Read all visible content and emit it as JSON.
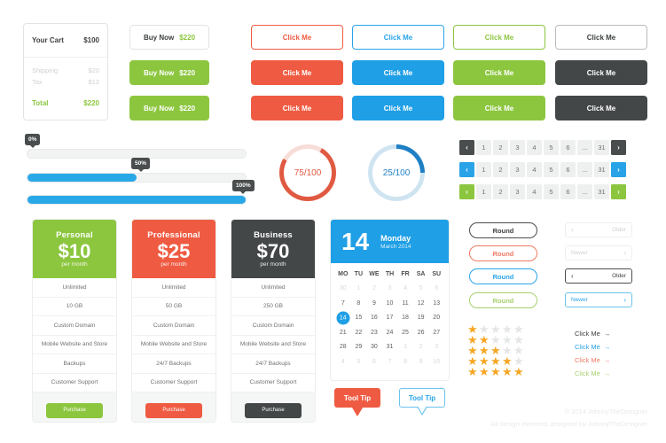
{
  "cart": {
    "title": "Your Cart",
    "total_top": "$100",
    "rows": [
      {
        "label": "Shipping",
        "value": "$20"
      },
      {
        "label": "Tax",
        "value": "$12"
      }
    ],
    "total_label": "Total",
    "total_value": "$220"
  },
  "buy": {
    "label": "Buy Now",
    "amount": "$220",
    "variants": [
      "outline",
      "solid",
      "solid"
    ]
  },
  "click_buttons": {
    "label": "Click Me",
    "columns": [
      "red",
      "blue",
      "green",
      "dark"
    ],
    "rows": [
      "outline",
      "solid",
      "solid"
    ]
  },
  "progress": [
    {
      "percent_label": "0%",
      "value": 0
    },
    {
      "percent_label": "50%",
      "value": 50
    },
    {
      "percent_label": "100%",
      "value": 100
    }
  ],
  "donuts": [
    {
      "label": "75/100",
      "value": 75,
      "color": "#e05a42",
      "track": "#f7ddd7"
    },
    {
      "label": "25/100",
      "value": 25,
      "color": "#1f7fc4",
      "track": "#cfe4f1"
    }
  ],
  "pagination": {
    "prev_icon": "chevron-left-icon",
    "next_icon": "chevron-right-icon",
    "pages": [
      "1",
      "2",
      "3",
      "4",
      "5",
      "6",
      "...",
      "31"
    ],
    "rows": [
      {
        "accent": "#4a4d4e"
      },
      {
        "accent": "#29a3e8"
      },
      {
        "accent": "#8cc63f"
      }
    ]
  },
  "pricing": [
    {
      "name": "Personal",
      "amount": "$10",
      "period": "per month",
      "accent": "#8cc63f",
      "features": [
        "Unlimited",
        "10 GB",
        "Custom Domain",
        "Mobile Website and Store",
        "Backups",
        "Customer Support"
      ],
      "cta": "Purchase"
    },
    {
      "name": "Professional",
      "amount": "$25",
      "period": "per month",
      "accent": "#ef5b42",
      "features": [
        "Unlimited",
        "50 GB",
        "Custom Domain",
        "Mobile Website and Store",
        "24/7 Backups",
        "Customer Support"
      ],
      "cta": "Purchase"
    },
    {
      "name": "Business",
      "amount": "$70",
      "period": "per month",
      "accent": "#444748",
      "features": [
        "Unlimited",
        "250 GB",
        "Custom Domain",
        "Mobile Website and Store",
        "24/7 Backups",
        "Customer Support"
      ],
      "cta": "Purchase"
    }
  ],
  "calendar": {
    "day_number": "14",
    "weekday": "Monday",
    "month_year": "March 2014",
    "dow": [
      "MO",
      "TU",
      "WE",
      "TH",
      "FR",
      "SA",
      "SU"
    ],
    "weeks": [
      [
        {
          "d": "30",
          "m": true
        },
        {
          "d": "1",
          "m": true
        },
        {
          "d": "2",
          "m": true
        },
        {
          "d": "3",
          "m": true
        },
        {
          "d": "4",
          "m": true
        },
        {
          "d": "5",
          "m": true
        },
        {
          "d": "6",
          "m": true
        }
      ],
      [
        {
          "d": "7"
        },
        {
          "d": "8"
        },
        {
          "d": "9"
        },
        {
          "d": "10"
        },
        {
          "d": "11"
        },
        {
          "d": "12"
        },
        {
          "d": "13"
        }
      ],
      [
        {
          "d": "14",
          "sel": true
        },
        {
          "d": "15"
        },
        {
          "d": "16"
        },
        {
          "d": "17"
        },
        {
          "d": "18"
        },
        {
          "d": "19"
        },
        {
          "d": "20"
        }
      ],
      [
        {
          "d": "21"
        },
        {
          "d": "22"
        },
        {
          "d": "23"
        },
        {
          "d": "24"
        },
        {
          "d": "25"
        },
        {
          "d": "26"
        },
        {
          "d": "27"
        }
      ],
      [
        {
          "d": "28"
        },
        {
          "d": "29"
        },
        {
          "d": "30"
        },
        {
          "d": "31"
        },
        {
          "d": "1",
          "m": true
        },
        {
          "d": "2",
          "m": true
        },
        {
          "d": "3",
          "m": true
        }
      ],
      [
        {
          "d": "4",
          "m": true
        },
        {
          "d": "5",
          "m": true
        },
        {
          "d": "6",
          "m": true
        },
        {
          "d": "7",
          "m": true
        },
        {
          "d": "8",
          "m": true
        },
        {
          "d": "9",
          "m": true
        },
        {
          "d": "10",
          "m": true
        }
      ]
    ]
  },
  "round_buttons": {
    "label": "Round",
    "variants": [
      "dark",
      "red",
      "blue",
      "green"
    ]
  },
  "nav_buttons": [
    {
      "left_label": "",
      "right_label": "Older",
      "icon": "chevron-left-icon",
      "style": "light-older"
    },
    {
      "left_label": "Newer",
      "right_label": "",
      "icon": "chevron-right-icon",
      "style": "light-newer"
    },
    {
      "left_label": "",
      "right_label": "Older",
      "icon": "chevron-left-icon",
      "style": "dark-older"
    },
    {
      "left_label": "Newer",
      "right_label": "",
      "icon": "chevron-right-icon",
      "style": "blue-newer"
    }
  ],
  "stars": {
    "max": 5,
    "rows": [
      1,
      2,
      3,
      4,
      5
    ],
    "glyph": "★",
    "on_color": "#f5a623",
    "off_color": "#e3e6e5"
  },
  "click_links": [
    {
      "label": "Click Me",
      "arrow": "→",
      "color": "dark"
    },
    {
      "label": "Click Me",
      "arrow": "→",
      "color": "blue"
    },
    {
      "label": "Click Me",
      "arrow": "→",
      "color": "red"
    },
    {
      "label": "Click Me",
      "arrow": "→",
      "color": "green"
    }
  ],
  "tooltips": [
    {
      "label": "Tool Tip",
      "style": "red"
    },
    {
      "label": "Tool Tip",
      "style": "blue"
    }
  ],
  "footer": {
    "copyright": "© 2014 JohnnyTheDesigner",
    "credit": "All design elements designed by JohnnyTheDesigner"
  }
}
